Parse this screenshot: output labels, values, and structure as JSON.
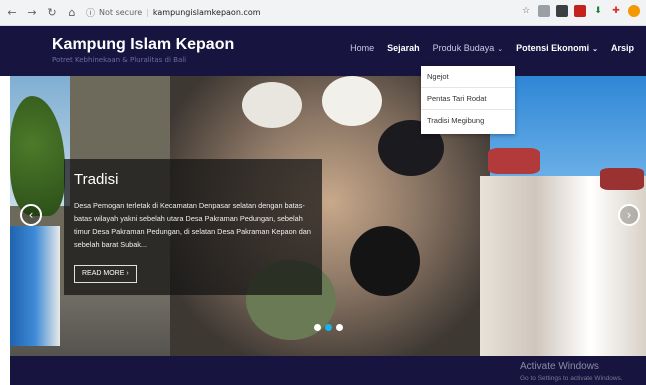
{
  "browser": {
    "security_label": "Not secure",
    "url": "kampungislamkepaon.com"
  },
  "site": {
    "title": "Kampung Islam Kepaon",
    "tagline": "Potret Kebhinekaan & Pluralitas di Bali"
  },
  "nav": {
    "home": "Home",
    "sejarah": "Sejarah",
    "produk_budaya": "Produk Budaya",
    "potensi_ekonomi": "Potensi Ekonomi",
    "arsip": "Arsip"
  },
  "dropdown": {
    "items": [
      "Ngejot",
      "Pentas Tari Rodat",
      "Tradisi Megibung"
    ]
  },
  "slide": {
    "title": "Tradisi",
    "text": "Desa Pemogan terletak di Kecamatan Denpasar selatan dengan batas-batas wilayah yakni sebelah utara Desa Pakraman Pedungan, sebelah timur Desa Pakraman Pedungan, di selatan Desa Pakraman Kepaon dan sebelah barat Subak...",
    "read_more": "READ MORE"
  },
  "windows": {
    "activate_title": "Activate Windows",
    "activate_sub": "Go to Settings to activate Windows."
  }
}
